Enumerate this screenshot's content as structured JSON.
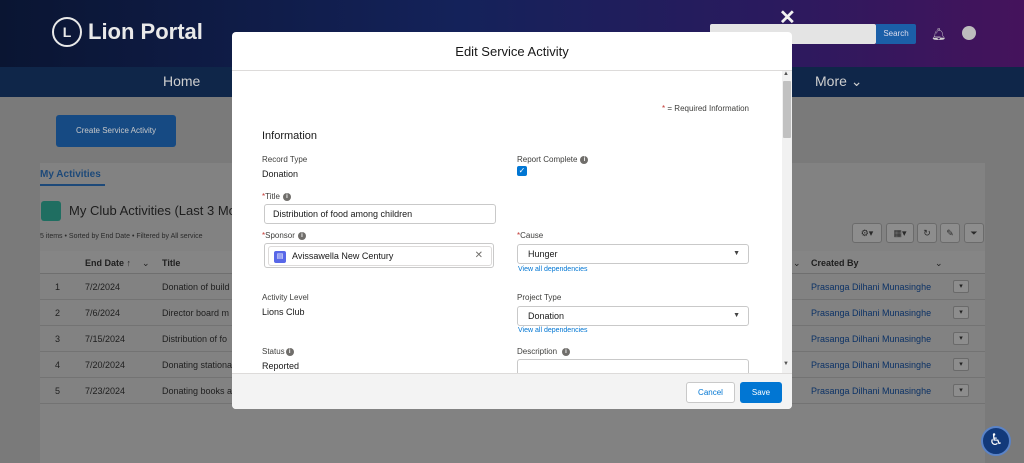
{
  "header": {
    "logo_text": "Lion Portal",
    "search_button": "Search",
    "nav": [
      "Home",
      "More ⌄"
    ]
  },
  "page": {
    "create_button": "Create Service Activity",
    "tab": "My Activities",
    "list_title": "My Club Activities (Last 3 Mo",
    "list_meta": "5 items • Sorted by End Date • Filtered by All service",
    "columns": {
      "end_date": "End Date ↑",
      "title": "Title",
      "created_by": "Created By"
    },
    "rows": [
      {
        "num": "1",
        "end_date": "7/2/2024",
        "title": "Donation of build",
        "created_by": "Prasanga Dilhani Munasinghe"
      },
      {
        "num": "2",
        "end_date": "7/6/2024",
        "title": "Director board m",
        "created_by": "Prasanga Dilhani Munasinghe"
      },
      {
        "num": "3",
        "end_date": "7/15/2024",
        "title": "Distribution of fo",
        "created_by": "Prasanga Dilhani Munasinghe"
      },
      {
        "num": "4",
        "end_date": "7/20/2024",
        "title": "Donating stationa",
        "created_by": "Prasanga Dilhani Munasinghe"
      },
      {
        "num": "5",
        "end_date": "7/23/2024",
        "title": "Donating books a",
        "created_by": "Prasanga Dilhani Munasinghe"
      }
    ]
  },
  "modal": {
    "title": "Edit Service Activity",
    "required_info": "= Required Information",
    "required_star": "*",
    "section": "Information",
    "fields": {
      "record_type": {
        "label": "Record Type",
        "value": "Donation"
      },
      "report_complete": {
        "label": "Report Complete",
        "checked": true
      },
      "title": {
        "label": "Title",
        "value": "Distribution of food among children"
      },
      "sponsor": {
        "label": "Sponsor",
        "value": "Avissawella New Century"
      },
      "cause": {
        "label": "Cause",
        "value": "Hunger",
        "link": "View all dependencies"
      },
      "activity_level": {
        "label": "Activity Level",
        "value": "Lions Club"
      },
      "project_type": {
        "label": "Project Type",
        "value": "Donation",
        "link": "View all dependencies"
      },
      "status": {
        "label": "Status",
        "value": "Reported"
      },
      "description": {
        "label": "Description"
      }
    },
    "cancel": "Cancel",
    "save": "Save"
  },
  "colors": {
    "brand": "#0176d3",
    "header_dark": "#0a1532"
  },
  "icons": [
    "lion-logo-icon",
    "bell-icon",
    "user-icon",
    "close-icon",
    "info-icon",
    "account-icon",
    "accessibility-icon"
  ]
}
